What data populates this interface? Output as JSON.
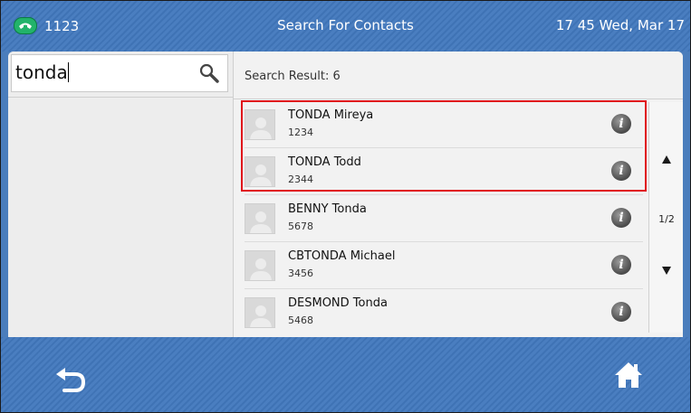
{
  "status_bar": {
    "account": "1123",
    "title": "Search For Contacts",
    "datetime": "17 45  Wed, Mar 17",
    "account_icon": "phone-handset-icon"
  },
  "search": {
    "value": "tonda",
    "icon": "search-icon"
  },
  "results": {
    "label": "Search Result: 6",
    "contacts": [
      {
        "name": "TONDA Mireya",
        "number": "1234"
      },
      {
        "name": "TONDA Todd",
        "number": "2344"
      },
      {
        "name": "BENNY Tonda",
        "number": "5678"
      },
      {
        "name": "CBTONDA Michael",
        "number": "3456"
      },
      {
        "name": "DESMOND Tonda",
        "number": "5468"
      }
    ],
    "info_glyph": "i",
    "highlight_color": "#e0111b"
  },
  "pager": {
    "page": "1/2"
  },
  "softkeys": {
    "back_icon": "back-arrow-icon",
    "home_icon": "home-icon"
  },
  "colors": {
    "bar": "#4a7dbc",
    "phone_status": "#22b36a"
  }
}
